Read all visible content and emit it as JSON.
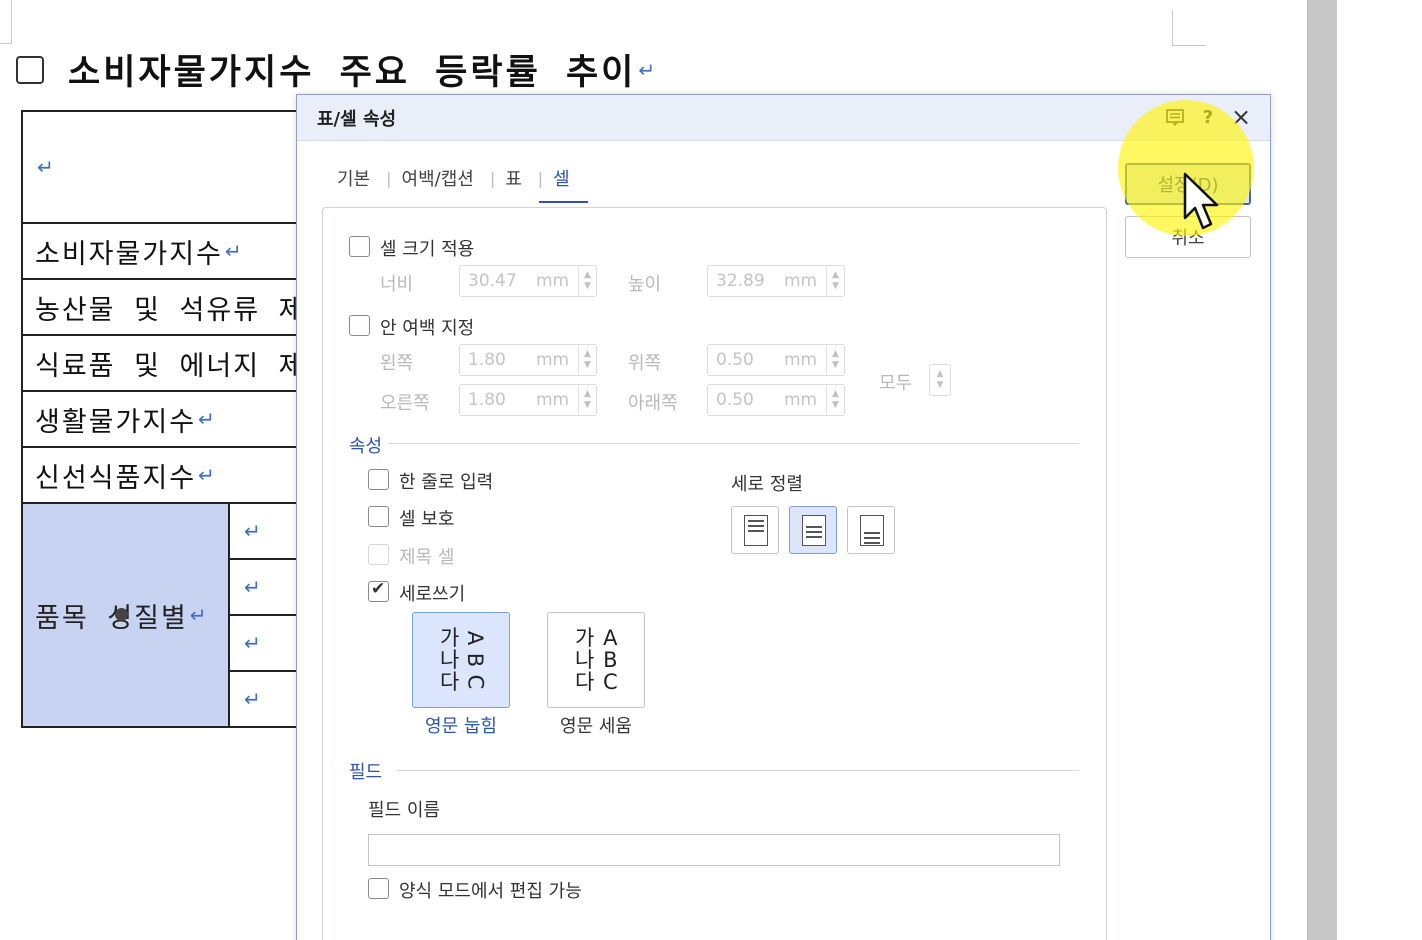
{
  "document": {
    "heading": "소비자물가지수 주요 등락률 추이",
    "para_mark": "↵",
    "table_rows": [
      "소비자물가지수",
      "농산물 및 석유류 제",
      "식료품 및 에너지 제",
      "생활물가지수",
      "신선식품지수"
    ],
    "merged_cell": "품목 성질별"
  },
  "dialog": {
    "title": "표/셀 속성",
    "memo_icon": "memo-icon",
    "help_label": "?",
    "close_label": "×",
    "tabs": [
      "기본",
      "여백/캡션",
      "표",
      "셀"
    ],
    "active_tab": "셀",
    "cell_size": {
      "checkbox_label": "셀 크기 적용",
      "checked": false,
      "width_label": "너비",
      "width_value": "30.47",
      "height_label": "높이",
      "height_value": "32.89",
      "unit": "mm"
    },
    "inner_margin": {
      "checkbox_label": "안 여백 지정",
      "checked": false,
      "left_label": "왼쪽",
      "left_value": "1.80",
      "top_label": "위쪽",
      "top_value": "0.50",
      "right_label": "오른쪽",
      "right_value": "1.80",
      "bottom_label": "아래쪽",
      "bottom_value": "0.50",
      "all_label": "모두",
      "unit": "mm"
    },
    "properties": {
      "section_title": "속성",
      "single_line": "한 줄로 입력",
      "protect_cell": "셀 보호",
      "title_cell": "제목 셀",
      "vertical_writing": "세로쓰기",
      "vertical_writing_checked": true,
      "vertical_align_label": "세로 정렬",
      "vertical_align_selected": "middle",
      "writing_options": [
        {
          "label": "영문 눕힘",
          "hangul": [
            "가",
            "나",
            "다"
          ],
          "latin": [
            "A",
            "B",
            "C"
          ],
          "selected": true
        },
        {
          "label": "영문 세움",
          "hangul": [
            "가",
            "나",
            "다"
          ],
          "latin": [
            "A",
            "B",
            "C"
          ],
          "selected": false
        }
      ]
    },
    "field": {
      "section_title": "필드",
      "name_label": "필드 이름",
      "name_value": "",
      "editable_label": "양식 모드에서 편집 가능"
    },
    "buttons": {
      "ok": "설정(D)",
      "cancel": "취소"
    }
  },
  "colors": {
    "accent": "#2a55a8",
    "selected_cell": "#c8d3f2",
    "highlight": "#fff400"
  }
}
